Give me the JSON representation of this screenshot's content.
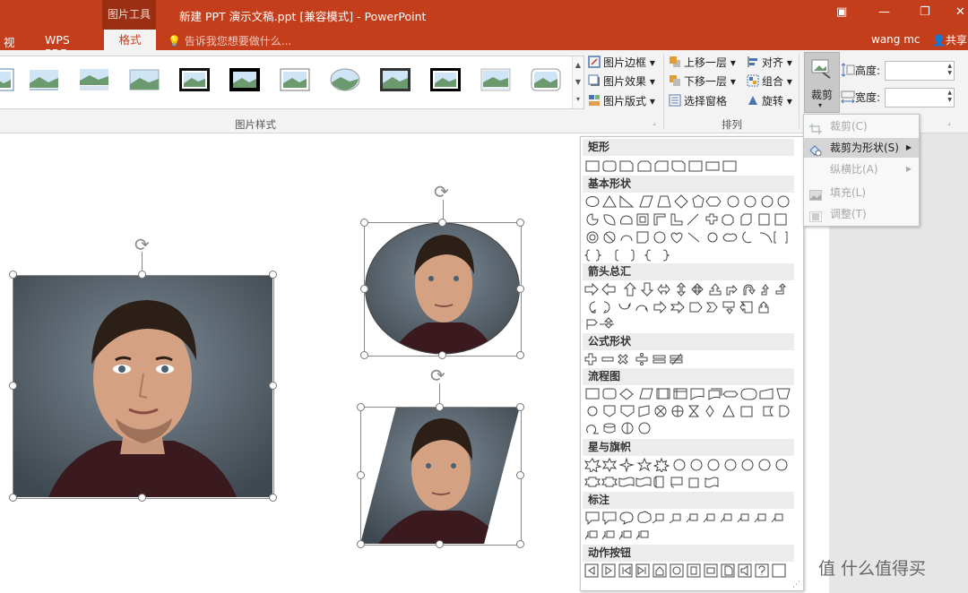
{
  "window": {
    "context_tab": "图片工具",
    "title": "新建 PPT 演示文稿.ppt [兼容模式] - PowerPoint",
    "user": "wang mc",
    "share": "共享"
  },
  "tabs": {
    "view": "视图",
    "wps_pdf": "WPS PDF",
    "format": "格式"
  },
  "tell_me": "告诉我您想要做什么...",
  "ribbon": {
    "picture_styles_label": "图片样式",
    "picture_border": "图片边框",
    "picture_effects": "图片效果",
    "picture_layout": "图片版式",
    "bring_forward": "上移一层",
    "send_backward": "下移一层",
    "selection_pane": "选择窗格",
    "align": "对齐",
    "group": "组合",
    "rotate": "旋转",
    "arrange_label": "排列",
    "crop": "裁剪",
    "height_label": "高度:",
    "width_label": "宽度:",
    "height_value": "",
    "width_value": ""
  },
  "crop_menu": {
    "crop": "裁剪(C)",
    "crop_to_shape": "裁剪为形状(S)",
    "aspect_ratio": "纵横比(A)",
    "fill": "填充(L)",
    "fit": "调整(T)"
  },
  "shapes": {
    "rect": "矩形",
    "basic": "基本形状",
    "arrows": "箭头总汇",
    "equation": "公式形状",
    "flowchart": "流程图",
    "stars": "星与旗帜",
    "callouts": "标注",
    "actions": "动作按钮"
  },
  "watermark": "值 什么值得买",
  "colors": {
    "accent": "#c43e1c",
    "accent_dark": "#9b2f14",
    "ribbon": "#f3f3f3"
  }
}
